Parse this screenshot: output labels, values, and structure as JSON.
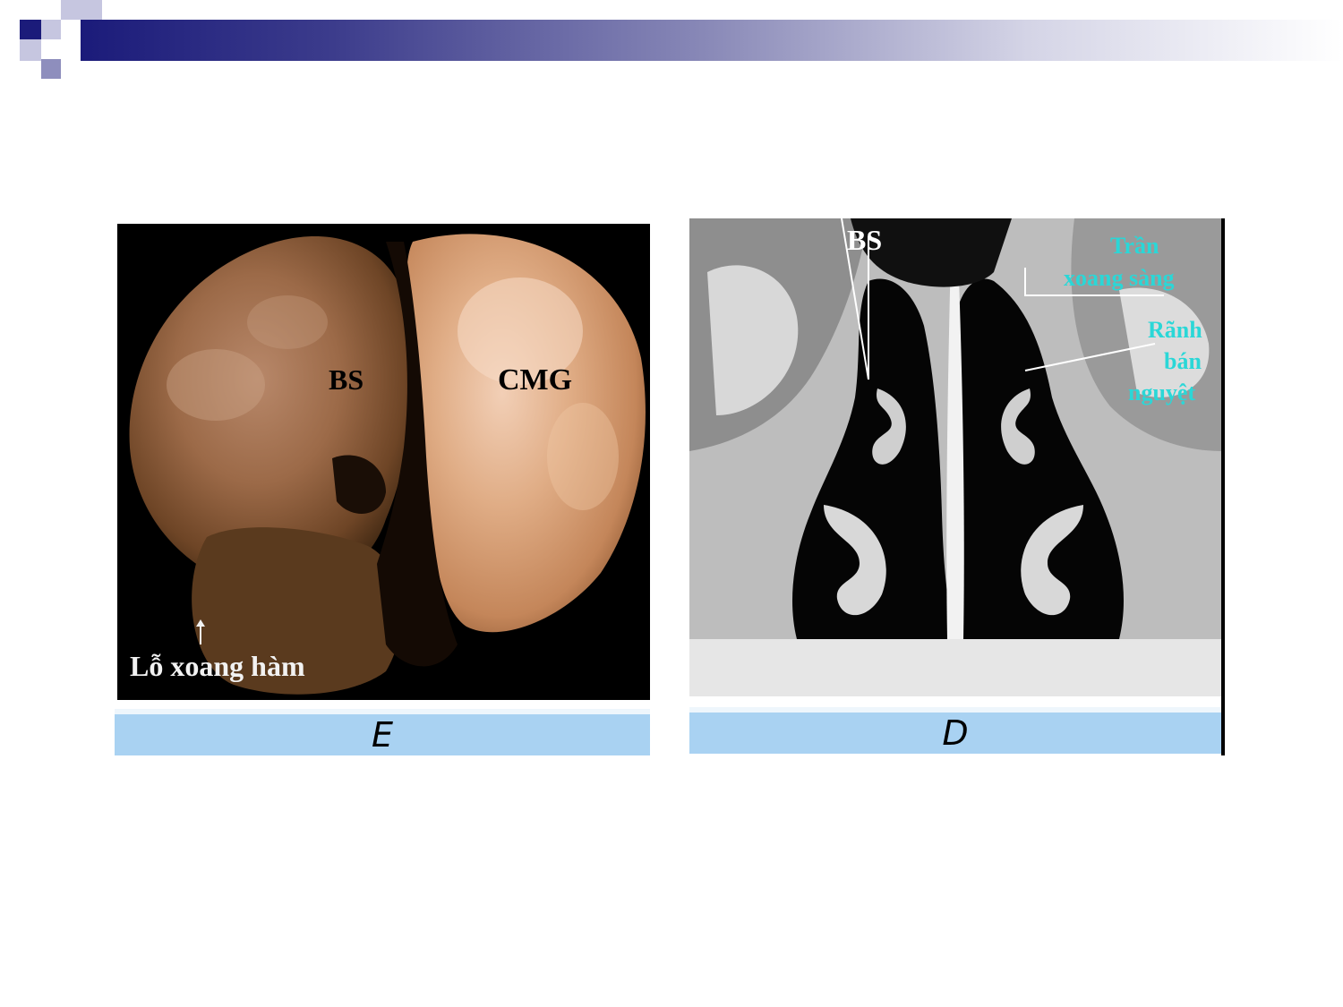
{
  "panels": [
    {
      "caption": "E",
      "labels": {
        "bs": "BS",
        "cmg": "CMG",
        "lo_xoang_ham": "Lỗ xoang hàm"
      }
    },
    {
      "caption": "D",
      "labels": {
        "bs": "BS",
        "tran": "Trần",
        "xoang_sang": "xoang sàng",
        "ranh": "Rãnh",
        "ban": "bán",
        "nguyet": "nguyệt"
      },
      "label_color": "#2ad7d7"
    }
  ],
  "colors": {
    "header_dark": "#1b1b7a",
    "caption_bar": "#a9d2f2"
  }
}
